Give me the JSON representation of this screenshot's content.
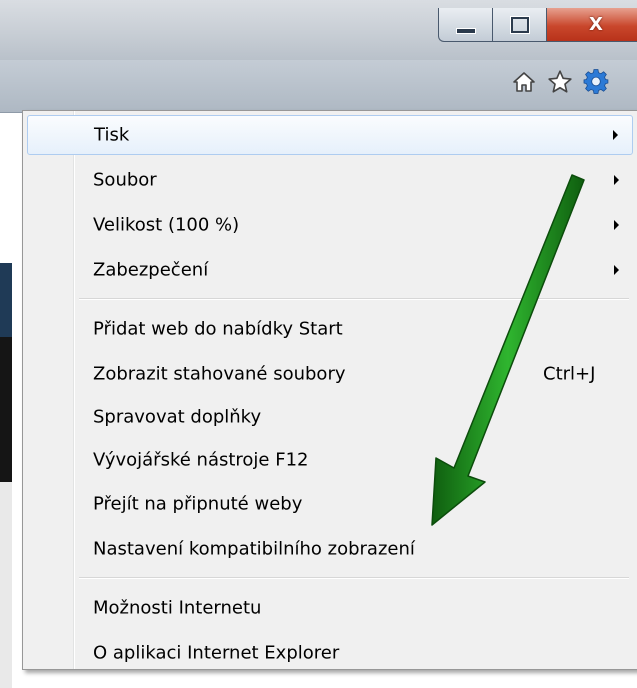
{
  "window_controls": {
    "minimize": "minimize",
    "maximize": "maximize",
    "close": "X"
  },
  "toolbar_icons": [
    "home-icon",
    "favorites-star-icon",
    "tools-gear-icon"
  ],
  "menu": {
    "groups": [
      [
        {
          "label": "Tisk",
          "submenu": true
        },
        {
          "label": "Soubor",
          "submenu": true
        },
        {
          "label": "Velikost (100 %)",
          "submenu": true
        },
        {
          "label": "Zabezpečení",
          "submenu": true
        }
      ],
      [
        {
          "label": "Přidat web do nabídky Start"
        },
        {
          "label": "Zobrazit stahované soubory",
          "shortcut": "Ctrl+J"
        },
        {
          "label": "Spravovat doplňky"
        },
        {
          "label": "Vývojářské nástroje F12"
        },
        {
          "label": "Přejít na připnuté weby"
        },
        {
          "label": "Nastavení kompatibilního zobrazení"
        }
      ],
      [
        {
          "label": "Možnosti Internetu"
        },
        {
          "label": "O aplikaci Internet Explorer"
        }
      ]
    ]
  },
  "colors": {
    "annotation_arrow": "#1e8a1e",
    "close_button": "#c9472c",
    "gear": "#2c7ad6"
  }
}
